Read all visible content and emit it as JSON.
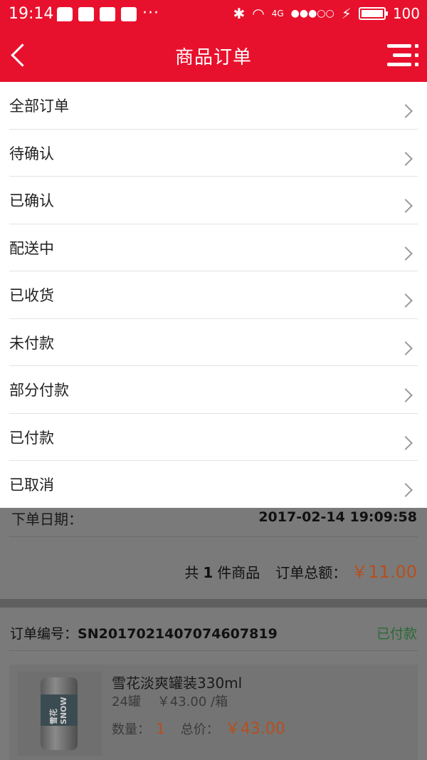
{
  "status_bar": {
    "time": "19:14",
    "network": "4G",
    "battery": "100",
    "more": "···"
  },
  "header": {
    "title": "商品订单"
  },
  "menu": {
    "items": [
      {
        "label": "全部订单"
      },
      {
        "label": "待确认"
      },
      {
        "label": "已确认"
      },
      {
        "label": "配送中"
      },
      {
        "label": "已收货"
      },
      {
        "label": "未付款"
      },
      {
        "label": "部分付款"
      },
      {
        "label": "已付款"
      },
      {
        "label": "已取消"
      }
    ]
  },
  "order_prev": {
    "date_label": "下单日期：",
    "date_value": "2017-02-14 19:09:58",
    "count_prefix": "共",
    "count": "1",
    "count_suffix": "件商品",
    "total_label": "订单总额：",
    "total_value": "￥11.00"
  },
  "order": {
    "sn_label": "订单编号：",
    "sn_value": "SN2017021407074607819",
    "status": "已付款",
    "product": {
      "name": "雪花淡爽罐装330ml",
      "spec_qty": "24罐",
      "spec_price": "￥43.00 /箱",
      "qty_label": "数量：",
      "qty": "1",
      "total_label": "总价：",
      "total": "￥43.00",
      "can_text": "雪花 SNOW"
    }
  },
  "colors": {
    "brand_red": "#e8112d",
    "price": "#e25c1a",
    "paid_green": "#2e8b3e"
  }
}
